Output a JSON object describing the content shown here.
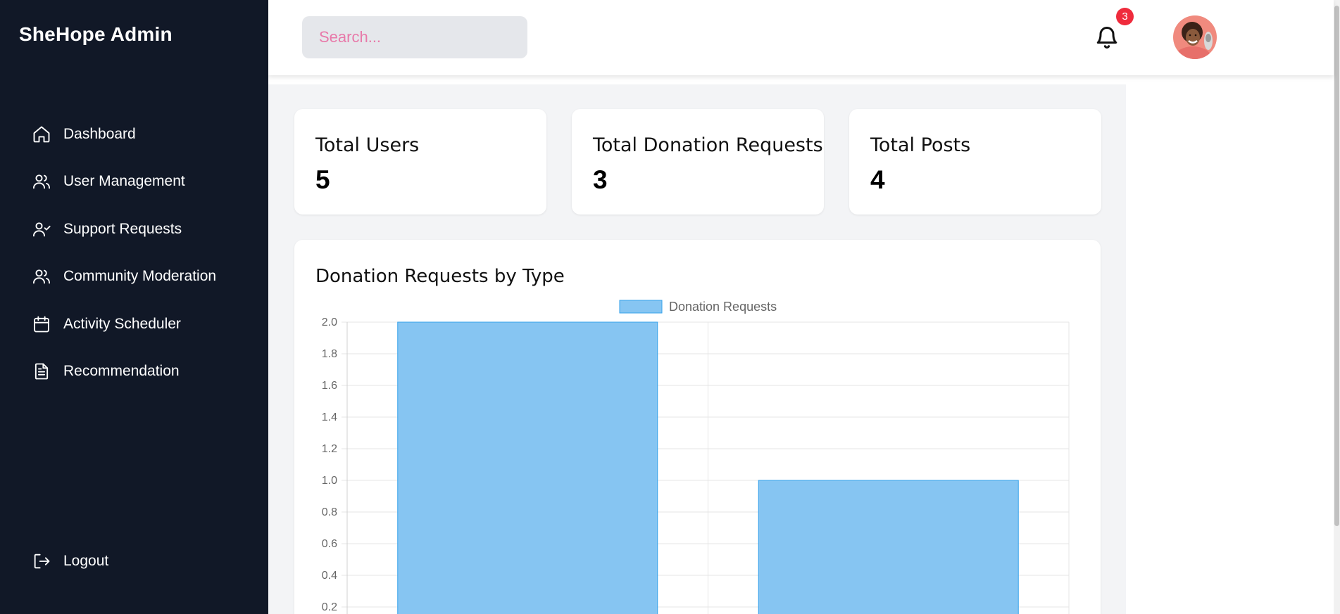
{
  "brand": "SheHope Admin",
  "sidebar": {
    "items": [
      {
        "label": "Dashboard",
        "icon": "home-icon"
      },
      {
        "label": "User Management",
        "icon": "users-icon"
      },
      {
        "label": "Support Requests",
        "icon": "user-check-icon"
      },
      {
        "label": "Community Moderation",
        "icon": "users-icon"
      },
      {
        "label": "Activity Scheduler",
        "icon": "calendar-icon"
      },
      {
        "label": "Recommendation",
        "icon": "document-icon"
      }
    ],
    "logout": {
      "label": "Logout",
      "icon": "logout-icon"
    }
  },
  "header": {
    "search_placeholder": "Search...",
    "notification_count": "3"
  },
  "stats": [
    {
      "title": "Total Users",
      "value": "5"
    },
    {
      "title": "Total Donation Requests",
      "value": "3"
    },
    {
      "title": "Total Posts",
      "value": "4"
    }
  ],
  "colors": {
    "sidebar_bg": "#111827",
    "bar_fill": "#86c5f2",
    "bar_border": "#36a2eb",
    "badge": "#ef2b3c"
  },
  "chart": {
    "title": "Donation Requests by Type"
  },
  "chart_data": {
    "type": "bar",
    "categories": [
      "",
      ""
    ],
    "series": [
      {
        "name": "Donation Requests",
        "values": [
          2,
          1
        ]
      }
    ],
    "ylim": [
      0,
      2
    ],
    "yticks": [
      "2.0",
      "1.8",
      "1.6",
      "1.4",
      "1.2",
      "1.0",
      "0.8",
      "0.6",
      "0.4",
      "0.2"
    ],
    "grid": true,
    "legend": "top-center"
  }
}
